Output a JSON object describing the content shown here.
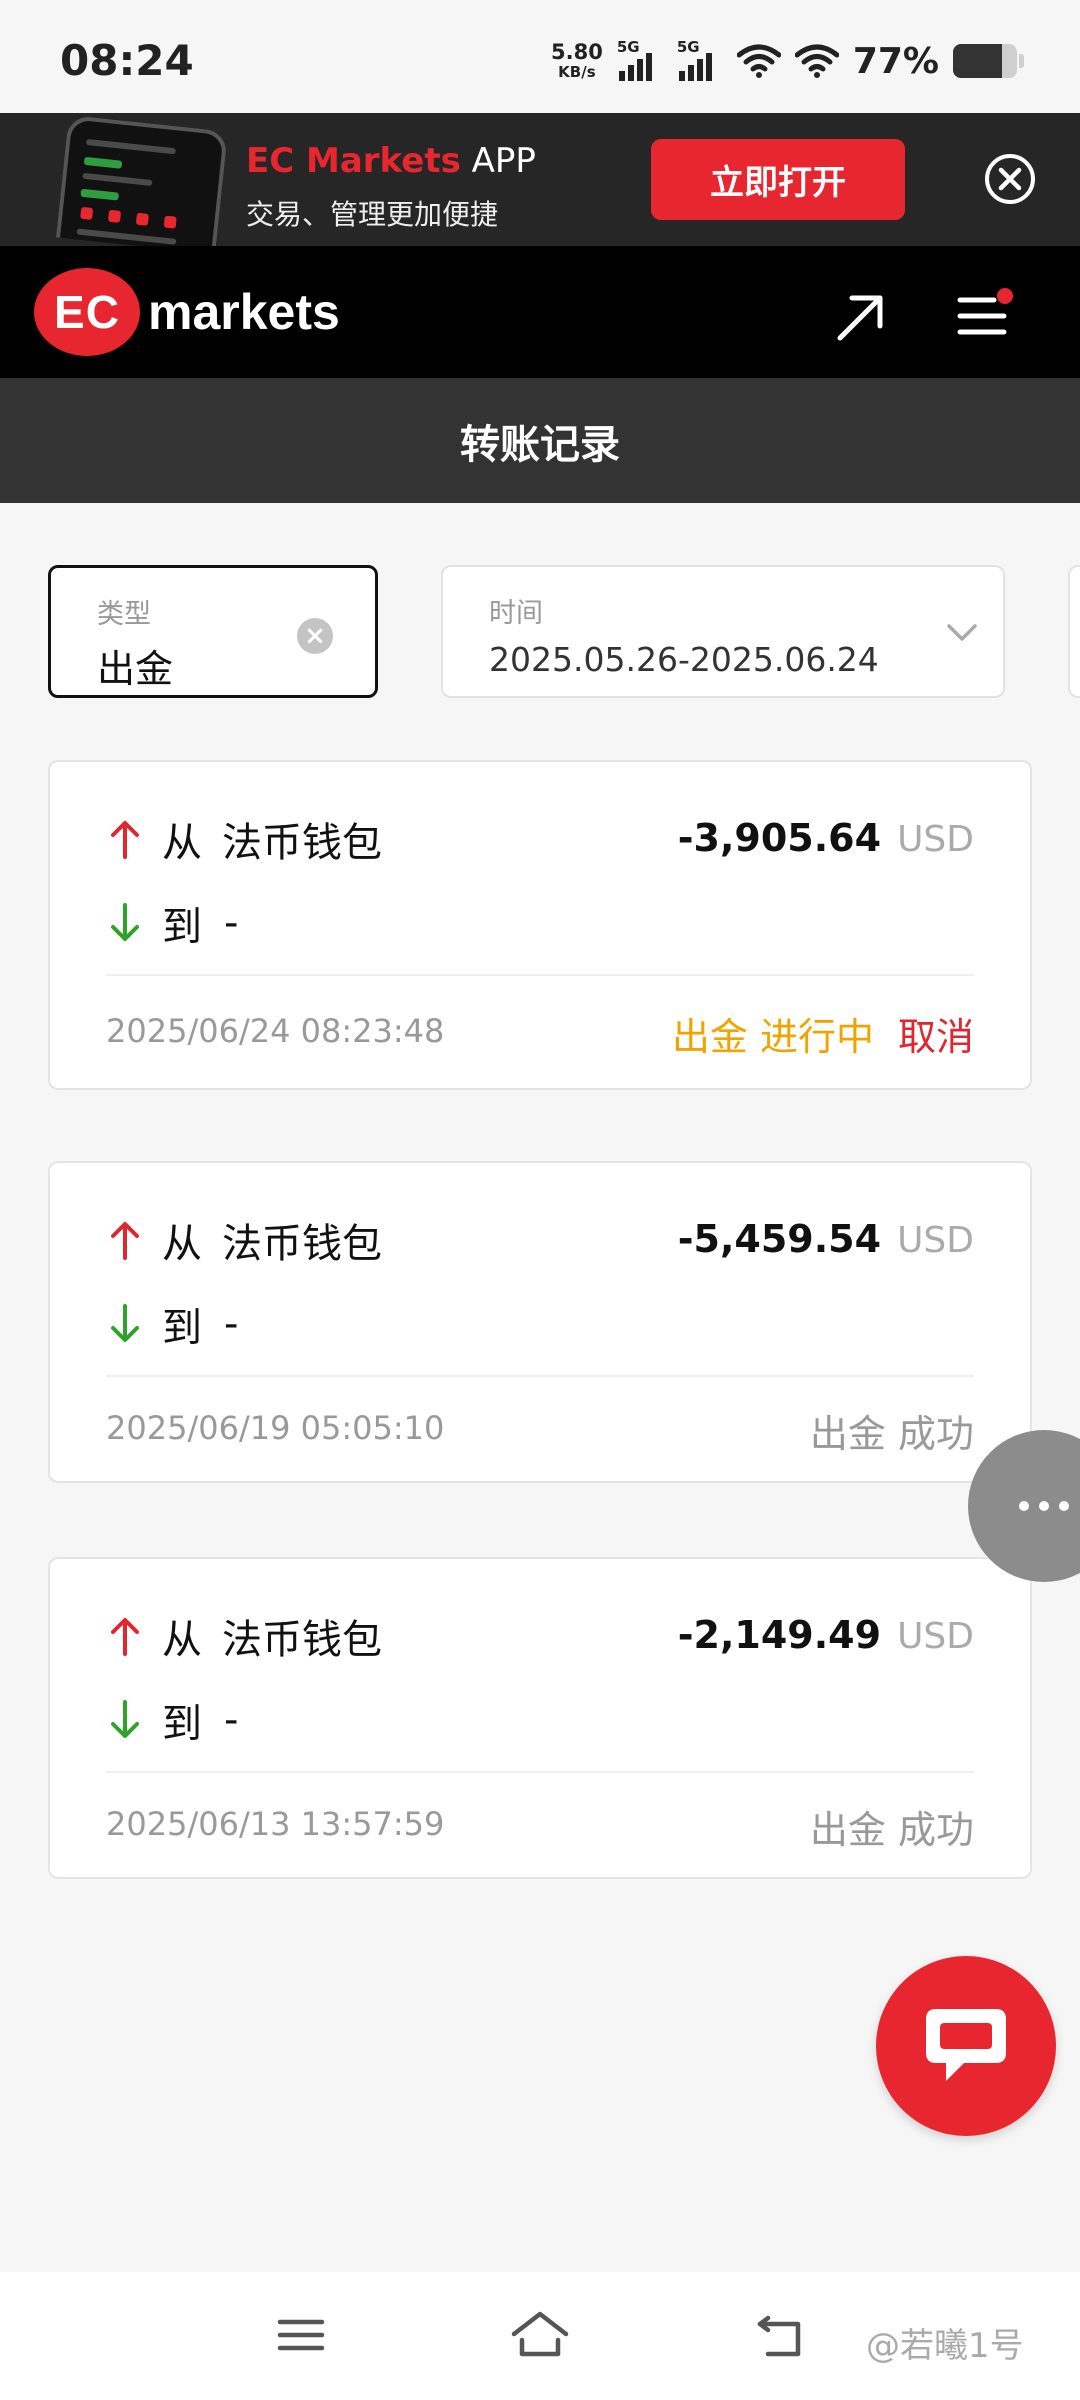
{
  "status_bar": {
    "time": "08:24",
    "net_speed_value": "5.80",
    "net_speed_unit": "KB/s",
    "sim1": "5G",
    "sim2": "5G",
    "battery_percent": "77%",
    "battery_level": 0.77
  },
  "app_banner": {
    "brand": "EC Markets",
    "app_word": "APP",
    "subtitle": "交易、管理更加便捷",
    "open_button": "立即打开"
  },
  "header": {
    "logo_badge": "EC",
    "logo_text": "markets"
  },
  "page_title": "转账记录",
  "filters": {
    "type": {
      "label": "类型",
      "value": "出金"
    },
    "time": {
      "label": "时间",
      "value": "2025.05.26-2025.06.24"
    }
  },
  "records": [
    {
      "from_word": "从",
      "from_wallet": "法币钱包",
      "to_word": "到",
      "to_wallet": "-",
      "amount": "-3,905.64",
      "currency": "USD",
      "timestamp": "2025/06/24 08:23:48",
      "status": "出金 进行中",
      "action": "取消"
    },
    {
      "from_word": "从",
      "from_wallet": "法币钱包",
      "to_word": "到",
      "to_wallet": "-",
      "amount": "-5,459.54",
      "currency": "USD",
      "timestamp": "2025/06/19 05:05:10",
      "status": "出金 成功"
    },
    {
      "from_word": "从",
      "from_wallet": "法币钱包",
      "to_word": "到",
      "to_wallet": "-",
      "amount": "-2,149.49",
      "currency": "USD",
      "timestamp": "2025/06/13 13:57:59",
      "status": "出金 成功"
    }
  ],
  "watermark": "@若曦1号",
  "colors": {
    "brand_red": "#e8262f",
    "in_progress": "#f0a400",
    "up_arrow": "#e0262e",
    "down_arrow": "#2ea32a"
  }
}
